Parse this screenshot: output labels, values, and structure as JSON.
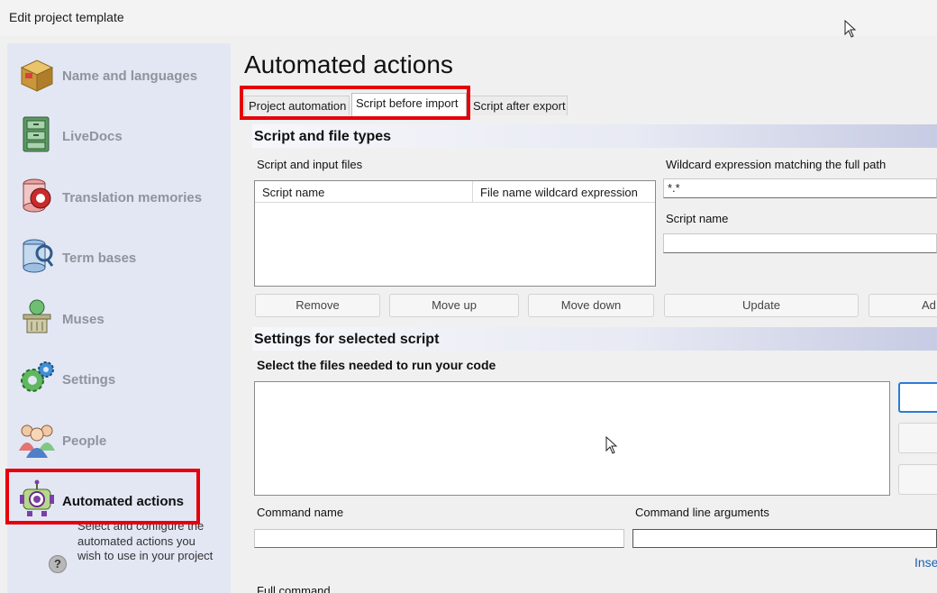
{
  "window": {
    "title": "Edit project template"
  },
  "sidebar": {
    "items": [
      {
        "label": "Name and languages",
        "icon": "box-icon"
      },
      {
        "label": "LiveDocs",
        "icon": "cabinet-icon"
      },
      {
        "label": "Translation memories",
        "icon": "memory-icon"
      },
      {
        "label": "Term bases",
        "icon": "database-icon"
      },
      {
        "label": "Muses",
        "icon": "muse-icon"
      },
      {
        "label": "Settings",
        "icon": "gear-icon"
      },
      {
        "label": "People",
        "icon": "people-icon"
      },
      {
        "label": "Automated actions",
        "icon": "robot-icon",
        "active": true
      }
    ],
    "help_text": "Select and configure the automated actions you wish to use in your project",
    "help_icon": "?"
  },
  "main": {
    "title": "Automated actions",
    "tabs": [
      {
        "label": "Project automation"
      },
      {
        "label": "Script before import",
        "active": true
      },
      {
        "label": "Script after export"
      }
    ],
    "section1": {
      "title": "Script and file types",
      "list_label": "Script and input files",
      "columns": [
        "Script name",
        "File name wildcard expression"
      ],
      "wildcard_label": "Wildcard expression matching the full path",
      "wildcard_value": "*.*",
      "script_name_label": "Script name",
      "script_name_value": "",
      "buttons": [
        "Remove",
        "Move up",
        "Move down",
        "Update",
        "Ad"
      ]
    },
    "section2": {
      "title": "Settings for selected script",
      "files_label": "Select the files needed to run your code",
      "command_name_label": "Command name",
      "command_args_label": "Command line arguments",
      "insert_link": "Inse",
      "full_command_label": "Full command"
    }
  },
  "colors": {
    "accent": "#e5000a",
    "focus": "#2b7bd6",
    "sidebar": "#e3e7f4"
  }
}
